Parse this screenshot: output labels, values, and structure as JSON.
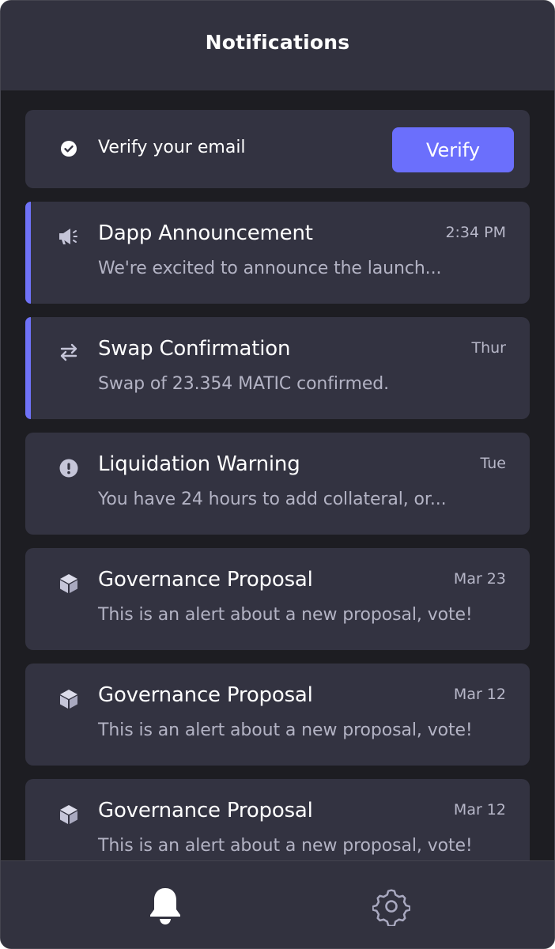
{
  "header": {
    "title": "Notifications"
  },
  "verify": {
    "text": "Verify your email",
    "button_label": "Verify",
    "icon": "check-circle-icon"
  },
  "notifications": [
    {
      "icon": "megaphone-icon",
      "title": "Dapp Announcement",
      "time": "2:34 PM",
      "body": "We're excited to announce the launch...",
      "unread": true
    },
    {
      "icon": "swap-arrows-icon",
      "title": "Swap Confirmation",
      "time": "Thur",
      "body": "Swap of 23.354 MATIC confirmed.",
      "unread": true
    },
    {
      "icon": "warning-circle-icon",
      "title": "Liquidation Warning",
      "time": "Tue",
      "body": "You have 24 hours to add collateral, or...",
      "unread": false
    },
    {
      "icon": "cube-icon",
      "title": "Governance Proposal",
      "time": "Mar 23",
      "body": "This is an alert about a new proposal, vote!",
      "unread": false
    },
    {
      "icon": "cube-icon",
      "title": "Governance Proposal",
      "time": "Mar 12",
      "body": "This is an alert about a new proposal, vote!",
      "unread": false
    },
    {
      "icon": "cube-icon",
      "title": "Governance Proposal",
      "time": "Mar 12",
      "body": "This is an alert about a new proposal, vote!",
      "unread": false
    }
  ],
  "tabbar": {
    "items": [
      {
        "icon": "bell-icon",
        "active": true
      },
      {
        "icon": "gear-icon",
        "active": false
      }
    ]
  },
  "colors": {
    "accent": "#6b6ffc",
    "background": "#1d1d22",
    "card": "#333341",
    "header": "#32323f",
    "icon_muted": "#c5c5d8"
  }
}
